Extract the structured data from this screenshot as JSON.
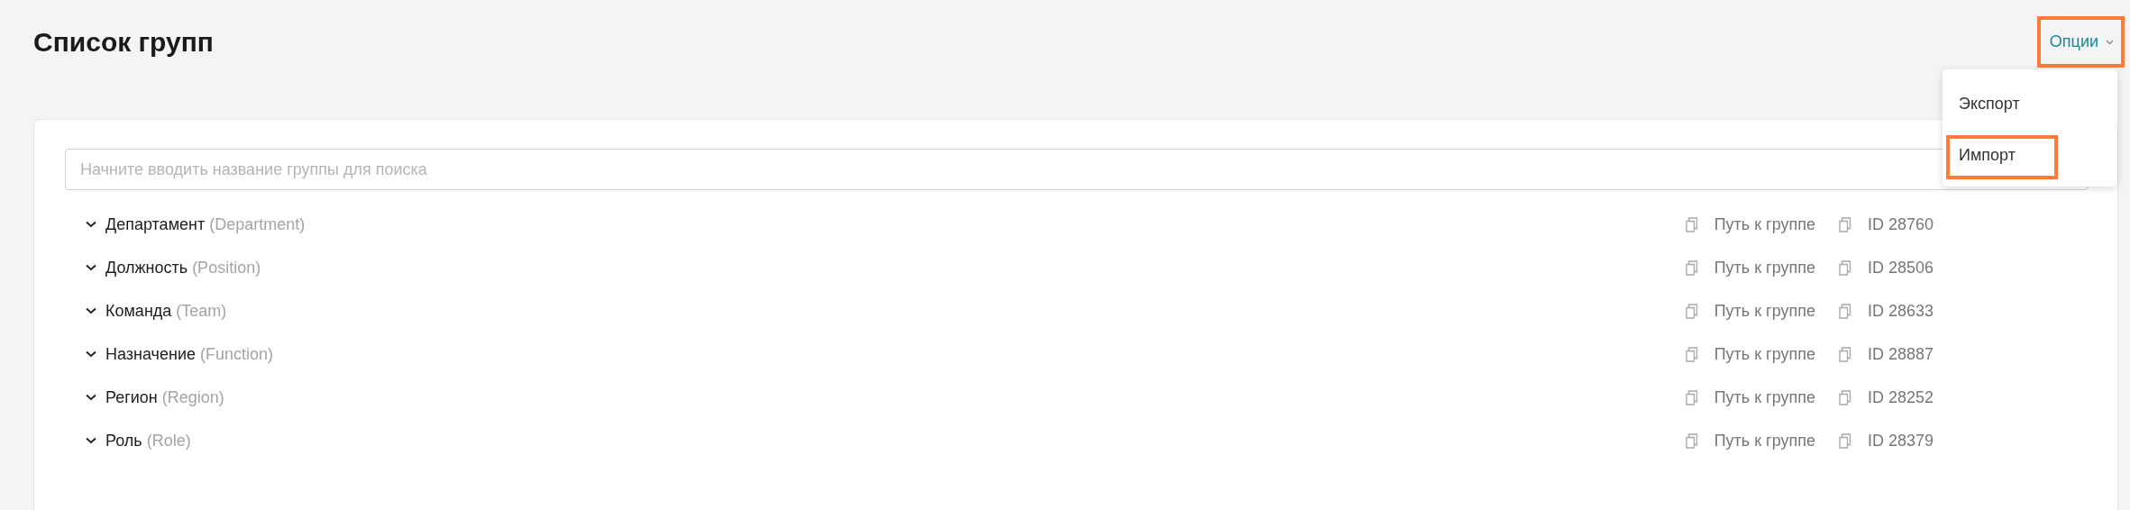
{
  "page_title": "Список групп",
  "options_menu": {
    "label": "Опции",
    "highlighted": true,
    "expanded": true,
    "items": [
      {
        "label": "Экспорт",
        "highlighted": false
      },
      {
        "label": "Импорт",
        "highlighted": true
      }
    ]
  },
  "search": {
    "placeholder": "Начните вводить название группы для поиска"
  },
  "groups": [
    {
      "name": "Департамент",
      "code": "(Department)",
      "expanded": false,
      "path_label": "Путь к группе",
      "id": "ID 28760"
    },
    {
      "name": "Должность",
      "code": "(Position)",
      "expanded": false,
      "path_label": "Путь к группе",
      "id": "ID 28506"
    },
    {
      "name": "Команда",
      "code": "(Team)",
      "expanded": false,
      "path_label": "Путь к группе",
      "id": "ID 28633"
    },
    {
      "name": "Назначение",
      "code": "(Function)",
      "expanded": false,
      "path_label": "Путь к группе",
      "id": "ID 28887"
    },
    {
      "name": "Регион",
      "code": "(Region)",
      "expanded": false,
      "path_label": "Путь к группе",
      "id": "ID 28252"
    },
    {
      "name": "Роль",
      "code": "(Role)",
      "expanded": false,
      "path_label": "Путь к группе",
      "id": "ID 28379"
    }
  ]
}
